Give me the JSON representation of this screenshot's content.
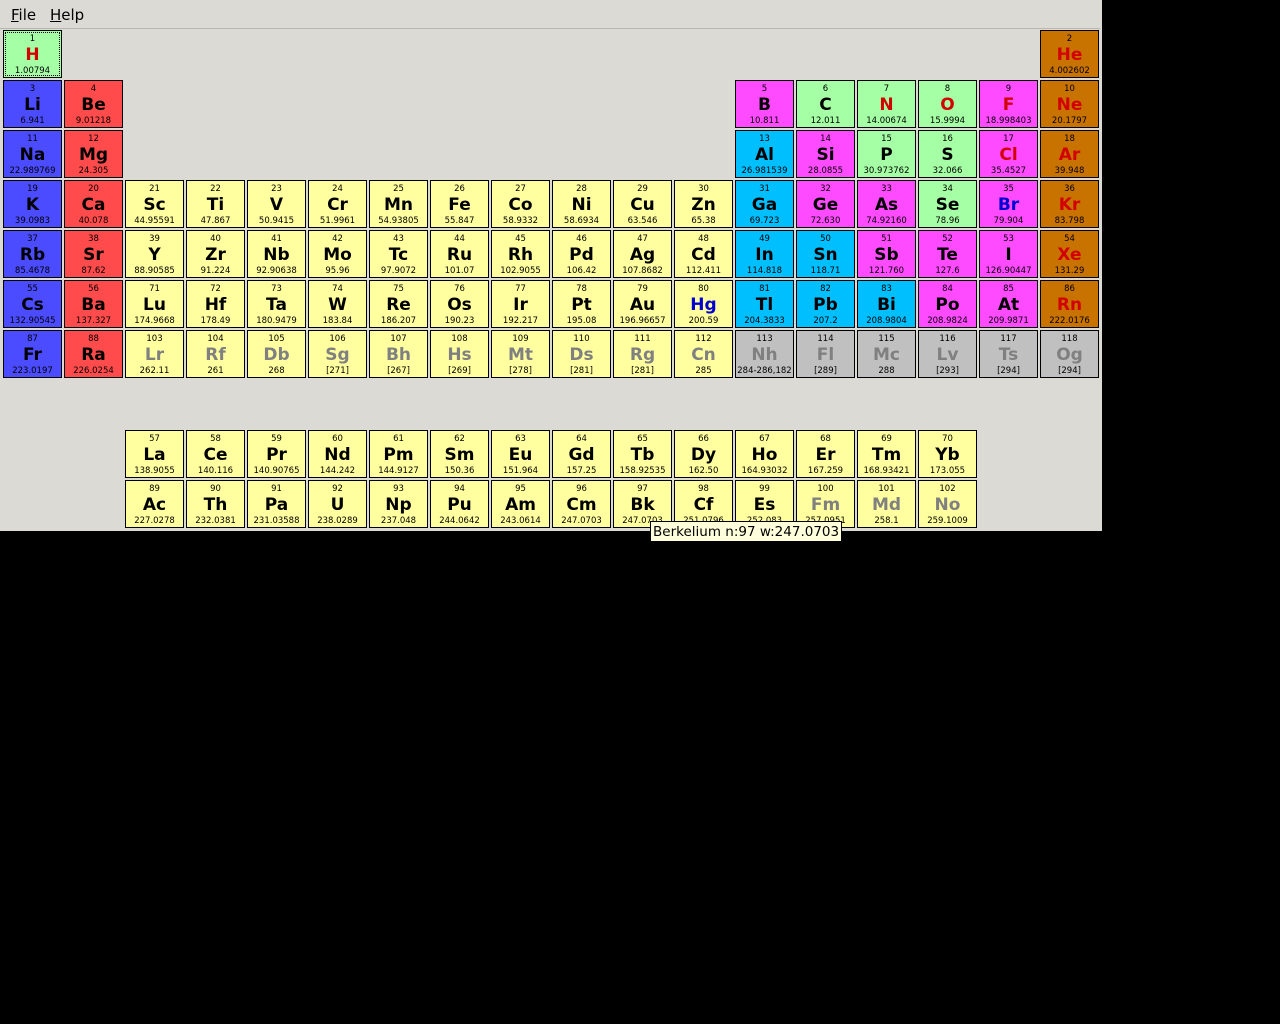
{
  "menu": {
    "file_label": "File",
    "help_label": "Help"
  },
  "tooltip": {
    "text": "Berkelium n:97 w:247.0703"
  },
  "colors": {
    "alkali": "#4b4bff",
    "alkaline": "#ff4b4b",
    "transition": "#ffff9f",
    "post_transition": "#00bfff",
    "metalloid": "#ff4bff",
    "nonmetal": "#a5ffa5",
    "noble": "#c87200",
    "unknown": "#c0c0c0",
    "sym_red": "#d20000",
    "sym_blue": "#0000d2",
    "sym_gray": "#808080",
    "sym_black": "#000000"
  },
  "elements": [
    {
      "n": "1",
      "s": "H",
      "w": "1.00794",
      "g": "nonmetal",
      "c": "sym_red",
      "r": 0,
      "col": 0,
      "selected": true
    },
    {
      "n": "2",
      "s": "He",
      "w": "4.002602",
      "g": "noble",
      "c": "sym_red",
      "r": 0,
      "col": 17
    },
    {
      "n": "3",
      "s": "Li",
      "w": "6.941",
      "g": "alkali",
      "c": "sym_black",
      "r": 1,
      "col": 0
    },
    {
      "n": "4",
      "s": "Be",
      "w": "9.01218",
      "g": "alkaline",
      "c": "sym_black",
      "r": 1,
      "col": 1
    },
    {
      "n": "5",
      "s": "B",
      "w": "10.811",
      "g": "metalloid",
      "c": "sym_black",
      "r": 1,
      "col": 12
    },
    {
      "n": "6",
      "s": "C",
      "w": "12.011",
      "g": "nonmetal",
      "c": "sym_black",
      "r": 1,
      "col": 13
    },
    {
      "n": "7",
      "s": "N",
      "w": "14.00674",
      "g": "nonmetal",
      "c": "sym_red",
      "r": 1,
      "col": 14
    },
    {
      "n": "8",
      "s": "O",
      "w": "15.9994",
      "g": "nonmetal",
      "c": "sym_red",
      "r": 1,
      "col": 15
    },
    {
      "n": "9",
      "s": "F",
      "w": "18.998403",
      "g": "metalloid",
      "c": "sym_red",
      "r": 1,
      "col": 16
    },
    {
      "n": "10",
      "s": "Ne",
      "w": "20.1797",
      "g": "noble",
      "c": "sym_red",
      "r": 1,
      "col": 17
    },
    {
      "n": "11",
      "s": "Na",
      "w": "22.989769",
      "g": "alkali",
      "c": "sym_black",
      "r": 2,
      "col": 0
    },
    {
      "n": "12",
      "s": "Mg",
      "w": "24.305",
      "g": "alkaline",
      "c": "sym_black",
      "r": 2,
      "col": 1
    },
    {
      "n": "13",
      "s": "Al",
      "w": "26.981539",
      "g": "post_transition",
      "c": "sym_black",
      "r": 2,
      "col": 12
    },
    {
      "n": "14",
      "s": "Si",
      "w": "28.0855",
      "g": "metalloid",
      "c": "sym_black",
      "r": 2,
      "col": 13
    },
    {
      "n": "15",
      "s": "P",
      "w": "30.973762",
      "g": "nonmetal",
      "c": "sym_black",
      "r": 2,
      "col": 14
    },
    {
      "n": "16",
      "s": "S",
      "w": "32.066",
      "g": "nonmetal",
      "c": "sym_black",
      "r": 2,
      "col": 15
    },
    {
      "n": "17",
      "s": "Cl",
      "w": "35.4527",
      "g": "metalloid",
      "c": "sym_red",
      "r": 2,
      "col": 16
    },
    {
      "n": "18",
      "s": "Ar",
      "w": "39.948",
      "g": "noble",
      "c": "sym_red",
      "r": 2,
      "col": 17
    },
    {
      "n": "19",
      "s": "K",
      "w": "39.0983",
      "g": "alkali",
      "c": "sym_black",
      "r": 3,
      "col": 0
    },
    {
      "n": "20",
      "s": "Ca",
      "w": "40.078",
      "g": "alkaline",
      "c": "sym_black",
      "r": 3,
      "col": 1
    },
    {
      "n": "21",
      "s": "Sc",
      "w": "44.95591",
      "g": "transition",
      "c": "sym_black",
      "r": 3,
      "col": 2
    },
    {
      "n": "22",
      "s": "Ti",
      "w": "47.867",
      "g": "transition",
      "c": "sym_black",
      "r": 3,
      "col": 3
    },
    {
      "n": "23",
      "s": "V",
      "w": "50.9415",
      "g": "transition",
      "c": "sym_black",
      "r": 3,
      "col": 4
    },
    {
      "n": "24",
      "s": "Cr",
      "w": "51.9961",
      "g": "transition",
      "c": "sym_black",
      "r": 3,
      "col": 5
    },
    {
      "n": "25",
      "s": "Mn",
      "w": "54.93805",
      "g": "transition",
      "c": "sym_black",
      "r": 3,
      "col": 6
    },
    {
      "n": "26",
      "s": "Fe",
      "w": "55.847",
      "g": "transition",
      "c": "sym_black",
      "r": 3,
      "col": 7
    },
    {
      "n": "27",
      "s": "Co",
      "w": "58.9332",
      "g": "transition",
      "c": "sym_black",
      "r": 3,
      "col": 8
    },
    {
      "n": "28",
      "s": "Ni",
      "w": "58.6934",
      "g": "transition",
      "c": "sym_black",
      "r": 3,
      "col": 9
    },
    {
      "n": "29",
      "s": "Cu",
      "w": "63.546",
      "g": "transition",
      "c": "sym_black",
      "r": 3,
      "col": 10
    },
    {
      "n": "30",
      "s": "Zn",
      "w": "65.38",
      "g": "transition",
      "c": "sym_black",
      "r": 3,
      "col": 11
    },
    {
      "n": "31",
      "s": "Ga",
      "w": "69.723",
      "g": "post_transition",
      "c": "sym_black",
      "r": 3,
      "col": 12
    },
    {
      "n": "32",
      "s": "Ge",
      "w": "72.630",
      "g": "metalloid",
      "c": "sym_black",
      "r": 3,
      "col": 13
    },
    {
      "n": "33",
      "s": "As",
      "w": "74.92160",
      "g": "metalloid",
      "c": "sym_black",
      "r": 3,
      "col": 14
    },
    {
      "n": "34",
      "s": "Se",
      "w": "78.96",
      "g": "nonmetal",
      "c": "sym_black",
      "r": 3,
      "col": 15
    },
    {
      "n": "35",
      "s": "Br",
      "w": "79.904",
      "g": "metalloid",
      "c": "sym_blue",
      "r": 3,
      "col": 16
    },
    {
      "n": "36",
      "s": "Kr",
      "w": "83.798",
      "g": "noble",
      "c": "sym_red",
      "r": 3,
      "col": 17
    },
    {
      "n": "37",
      "s": "Rb",
      "w": "85.4678",
      "g": "alkali",
      "c": "sym_black",
      "r": 4,
      "col": 0
    },
    {
      "n": "38",
      "s": "Sr",
      "w": "87.62",
      "g": "alkaline",
      "c": "sym_black",
      "r": 4,
      "col": 1
    },
    {
      "n": "39",
      "s": "Y",
      "w": "88.90585",
      "g": "transition",
      "c": "sym_black",
      "r": 4,
      "col": 2
    },
    {
      "n": "40",
      "s": "Zr",
      "w": "91.224",
      "g": "transition",
      "c": "sym_black",
      "r": 4,
      "col": 3
    },
    {
      "n": "41",
      "s": "Nb",
      "w": "92.90638",
      "g": "transition",
      "c": "sym_black",
      "r": 4,
      "col": 4
    },
    {
      "n": "42",
      "s": "Mo",
      "w": "95.96",
      "g": "transition",
      "c": "sym_black",
      "r": 4,
      "col": 5
    },
    {
      "n": "43",
      "s": "Tc",
      "w": "97.9072",
      "g": "transition",
      "c": "sym_black",
      "r": 4,
      "col": 6
    },
    {
      "n": "44",
      "s": "Ru",
      "w": "101.07",
      "g": "transition",
      "c": "sym_black",
      "r": 4,
      "col": 7
    },
    {
      "n": "45",
      "s": "Rh",
      "w": "102.9055",
      "g": "transition",
      "c": "sym_black",
      "r": 4,
      "col": 8
    },
    {
      "n": "46",
      "s": "Pd",
      "w": "106.42",
      "g": "transition",
      "c": "sym_black",
      "r": 4,
      "col": 9
    },
    {
      "n": "47",
      "s": "Ag",
      "w": "107.8682",
      "g": "transition",
      "c": "sym_black",
      "r": 4,
      "col": 10
    },
    {
      "n": "48",
      "s": "Cd",
      "w": "112.411",
      "g": "transition",
      "c": "sym_black",
      "r": 4,
      "col": 11
    },
    {
      "n": "49",
      "s": "In",
      "w": "114.818",
      "g": "post_transition",
      "c": "sym_black",
      "r": 4,
      "col": 12
    },
    {
      "n": "50",
      "s": "Sn",
      "w": "118.71",
      "g": "post_transition",
      "c": "sym_black",
      "r": 4,
      "col": 13
    },
    {
      "n": "51",
      "s": "Sb",
      "w": "121.760",
      "g": "metalloid",
      "c": "sym_black",
      "r": 4,
      "col": 14
    },
    {
      "n": "52",
      "s": "Te",
      "w": "127.6",
      "g": "metalloid",
      "c": "sym_black",
      "r": 4,
      "col": 15
    },
    {
      "n": "53",
      "s": "I",
      "w": "126.90447",
      "g": "metalloid",
      "c": "sym_black",
      "r": 4,
      "col": 16
    },
    {
      "n": "54",
      "s": "Xe",
      "w": "131.29",
      "g": "noble",
      "c": "sym_red",
      "r": 4,
      "col": 17
    },
    {
      "n": "55",
      "s": "Cs",
      "w": "132.90545",
      "g": "alkali",
      "c": "sym_black",
      "r": 5,
      "col": 0
    },
    {
      "n": "56",
      "s": "Ba",
      "w": "137.327",
      "g": "alkaline",
      "c": "sym_black",
      "r": 5,
      "col": 1
    },
    {
      "n": "71",
      "s": "Lu",
      "w": "174.9668",
      "g": "transition",
      "c": "sym_black",
      "r": 5,
      "col": 2
    },
    {
      "n": "72",
      "s": "Hf",
      "w": "178.49",
      "g": "transition",
      "c": "sym_black",
      "r": 5,
      "col": 3
    },
    {
      "n": "73",
      "s": "Ta",
      "w": "180.9479",
      "g": "transition",
      "c": "sym_black",
      "r": 5,
      "col": 4
    },
    {
      "n": "74",
      "s": "W",
      "w": "183.84",
      "g": "transition",
      "c": "sym_black",
      "r": 5,
      "col": 5
    },
    {
      "n": "75",
      "s": "Re",
      "w": "186.207",
      "g": "transition",
      "c": "sym_black",
      "r": 5,
      "col": 6
    },
    {
      "n": "76",
      "s": "Os",
      "w": "190.23",
      "g": "transition",
      "c": "sym_black",
      "r": 5,
      "col": 7
    },
    {
      "n": "77",
      "s": "Ir",
      "w": "192.217",
      "g": "transition",
      "c": "sym_black",
      "r": 5,
      "col": 8
    },
    {
      "n": "78",
      "s": "Pt",
      "w": "195.08",
      "g": "transition",
      "c": "sym_black",
      "r": 5,
      "col": 9
    },
    {
      "n": "79",
      "s": "Au",
      "w": "196.96657",
      "g": "transition",
      "c": "sym_black",
      "r": 5,
      "col": 10
    },
    {
      "n": "80",
      "s": "Hg",
      "w": "200.59",
      "g": "transition",
      "c": "sym_blue",
      "r": 5,
      "col": 11
    },
    {
      "n": "81",
      "s": "Tl",
      "w": "204.3833",
      "g": "post_transition",
      "c": "sym_black",
      "r": 5,
      "col": 12
    },
    {
      "n": "82",
      "s": "Pb",
      "w": "207.2",
      "g": "post_transition",
      "c": "sym_black",
      "r": 5,
      "col": 13
    },
    {
      "n": "83",
      "s": "Bi",
      "w": "208.9804",
      "g": "post_transition",
      "c": "sym_black",
      "r": 5,
      "col": 14
    },
    {
      "n": "84",
      "s": "Po",
      "w": "208.9824",
      "g": "metalloid",
      "c": "sym_black",
      "r": 5,
      "col": 15
    },
    {
      "n": "85",
      "s": "At",
      "w": "209.9871",
      "g": "metalloid",
      "c": "sym_black",
      "r": 5,
      "col": 16
    },
    {
      "n": "86",
      "s": "Rn",
      "w": "222.0176",
      "g": "noble",
      "c": "sym_red",
      "r": 5,
      "col": 17
    },
    {
      "n": "87",
      "s": "Fr",
      "w": "223.0197",
      "g": "alkali",
      "c": "sym_black",
      "r": 6,
      "col": 0
    },
    {
      "n": "88",
      "s": "Ra",
      "w": "226.0254",
      "g": "alkaline",
      "c": "sym_black",
      "r": 6,
      "col": 1
    },
    {
      "n": "103",
      "s": "Lr",
      "w": "262.11",
      "g": "transition",
      "c": "sym_gray",
      "r": 6,
      "col": 2
    },
    {
      "n": "104",
      "s": "Rf",
      "w": "261",
      "g": "transition",
      "c": "sym_gray",
      "r": 6,
      "col": 3
    },
    {
      "n": "105",
      "s": "Db",
      "w": "268",
      "g": "transition",
      "c": "sym_gray",
      "r": 6,
      "col": 4
    },
    {
      "n": "106",
      "s": "Sg",
      "w": "[271]",
      "g": "transition",
      "c": "sym_gray",
      "r": 6,
      "col": 5
    },
    {
      "n": "107",
      "s": "Bh",
      "w": "[267]",
      "g": "transition",
      "c": "sym_gray",
      "r": 6,
      "col": 6
    },
    {
      "n": "108",
      "s": "Hs",
      "w": "[269]",
      "g": "transition",
      "c": "sym_gray",
      "r": 6,
      "col": 7
    },
    {
      "n": "109",
      "s": "Mt",
      "w": "[278]",
      "g": "transition",
      "c": "sym_gray",
      "r": 6,
      "col": 8
    },
    {
      "n": "110",
      "s": "Ds",
      "w": "[281]",
      "g": "transition",
      "c": "sym_gray",
      "r": 6,
      "col": 9
    },
    {
      "n": "111",
      "s": "Rg",
      "w": "[281]",
      "g": "transition",
      "c": "sym_gray",
      "r": 6,
      "col": 10
    },
    {
      "n": "112",
      "s": "Cn",
      "w": "285",
      "g": "transition",
      "c": "sym_gray",
      "r": 6,
      "col": 11
    },
    {
      "n": "113",
      "s": "Nh",
      "w": "284-286,182",
      "g": "unknown",
      "c": "sym_gray",
      "r": 6,
      "col": 12
    },
    {
      "n": "114",
      "s": "Fl",
      "w": "[289]",
      "g": "unknown",
      "c": "sym_gray",
      "r": 6,
      "col": 13
    },
    {
      "n": "115",
      "s": "Mc",
      "w": "288",
      "g": "unknown",
      "c": "sym_gray",
      "r": 6,
      "col": 14
    },
    {
      "n": "116",
      "s": "Lv",
      "w": "[293]",
      "g": "unknown",
      "c": "sym_gray",
      "r": 6,
      "col": 15
    },
    {
      "n": "117",
      "s": "Ts",
      "w": "[294]",
      "g": "unknown",
      "c": "sym_gray",
      "r": 6,
      "col": 16
    },
    {
      "n": "118",
      "s": "Og",
      "w": "[294]",
      "g": "unknown",
      "c": "sym_gray",
      "r": 6,
      "col": 17
    },
    {
      "n": "57",
      "s": "La",
      "w": "138.9055",
      "g": "transition",
      "c": "sym_black",
      "r": 8,
      "col": 2
    },
    {
      "n": "58",
      "s": "Ce",
      "w": "140.116",
      "g": "transition",
      "c": "sym_black",
      "r": 8,
      "col": 3
    },
    {
      "n": "59",
      "s": "Pr",
      "w": "140.90765",
      "g": "transition",
      "c": "sym_black",
      "r": 8,
      "col": 4
    },
    {
      "n": "60",
      "s": "Nd",
      "w": "144.242",
      "g": "transition",
      "c": "sym_black",
      "r": 8,
      "col": 5
    },
    {
      "n": "61",
      "s": "Pm",
      "w": "144.9127",
      "g": "transition",
      "c": "sym_black",
      "r": 8,
      "col": 6
    },
    {
      "n": "62",
      "s": "Sm",
      "w": "150.36",
      "g": "transition",
      "c": "sym_black",
      "r": 8,
      "col": 7
    },
    {
      "n": "63",
      "s": "Eu",
      "w": "151.964",
      "g": "transition",
      "c": "sym_black",
      "r": 8,
      "col": 8
    },
    {
      "n": "64",
      "s": "Gd",
      "w": "157.25",
      "g": "transition",
      "c": "sym_black",
      "r": 8,
      "col": 9
    },
    {
      "n": "65",
      "s": "Tb",
      "w": "158.92535",
      "g": "transition",
      "c": "sym_black",
      "r": 8,
      "col": 10
    },
    {
      "n": "66",
      "s": "Dy",
      "w": "162.50",
      "g": "transition",
      "c": "sym_black",
      "r": 8,
      "col": 11
    },
    {
      "n": "67",
      "s": "Ho",
      "w": "164.93032",
      "g": "transition",
      "c": "sym_black",
      "r": 8,
      "col": 12
    },
    {
      "n": "68",
      "s": "Er",
      "w": "167.259",
      "g": "transition",
      "c": "sym_black",
      "r": 8,
      "col": 13
    },
    {
      "n": "69",
      "s": "Tm",
      "w": "168.93421",
      "g": "transition",
      "c": "sym_black",
      "r": 8,
      "col": 14
    },
    {
      "n": "70",
      "s": "Yb",
      "w": "173.055",
      "g": "transition",
      "c": "sym_black",
      "r": 8,
      "col": 15
    },
    {
      "n": "89",
      "s": "Ac",
      "w": "227.0278",
      "g": "transition",
      "c": "sym_black",
      "r": 9,
      "col": 2
    },
    {
      "n": "90",
      "s": "Th",
      "w": "232.0381",
      "g": "transition",
      "c": "sym_black",
      "r": 9,
      "col": 3
    },
    {
      "n": "91",
      "s": "Pa",
      "w": "231.03588",
      "g": "transition",
      "c": "sym_black",
      "r": 9,
      "col": 4
    },
    {
      "n": "92",
      "s": "U",
      "w": "238.0289",
      "g": "transition",
      "c": "sym_black",
      "r": 9,
      "col": 5
    },
    {
      "n": "93",
      "s": "Np",
      "w": "237.048",
      "g": "transition",
      "c": "sym_black",
      "r": 9,
      "col": 6
    },
    {
      "n": "94",
      "s": "Pu",
      "w": "244.0642",
      "g": "transition",
      "c": "sym_black",
      "r": 9,
      "col": 7
    },
    {
      "n": "95",
      "s": "Am",
      "w": "243.0614",
      "g": "transition",
      "c": "sym_black",
      "r": 9,
      "col": 8
    },
    {
      "n": "96",
      "s": "Cm",
      "w": "247.0703",
      "g": "transition",
      "c": "sym_black",
      "r": 9,
      "col": 9
    },
    {
      "n": "97",
      "s": "Bk",
      "w": "247.0703",
      "g": "transition",
      "c": "sym_black",
      "r": 9,
      "col": 10
    },
    {
      "n": "98",
      "s": "Cf",
      "w": "251.0796",
      "g": "transition",
      "c": "sym_black",
      "r": 9,
      "col": 11
    },
    {
      "n": "99",
      "s": "Es",
      "w": "252.083",
      "g": "transition",
      "c": "sym_black",
      "r": 9,
      "col": 12
    },
    {
      "n": "100",
      "s": "Fm",
      "w": "257.0951",
      "g": "transition",
      "c": "sym_gray",
      "r": 9,
      "col": 13
    },
    {
      "n": "101",
      "s": "Md",
      "w": "258.1",
      "g": "transition",
      "c": "sym_gray",
      "r": 9,
      "col": 14
    },
    {
      "n": "102",
      "s": "No",
      "w": "259.1009",
      "g": "transition",
      "c": "sym_gray",
      "r": 9,
      "col": 15
    }
  ]
}
